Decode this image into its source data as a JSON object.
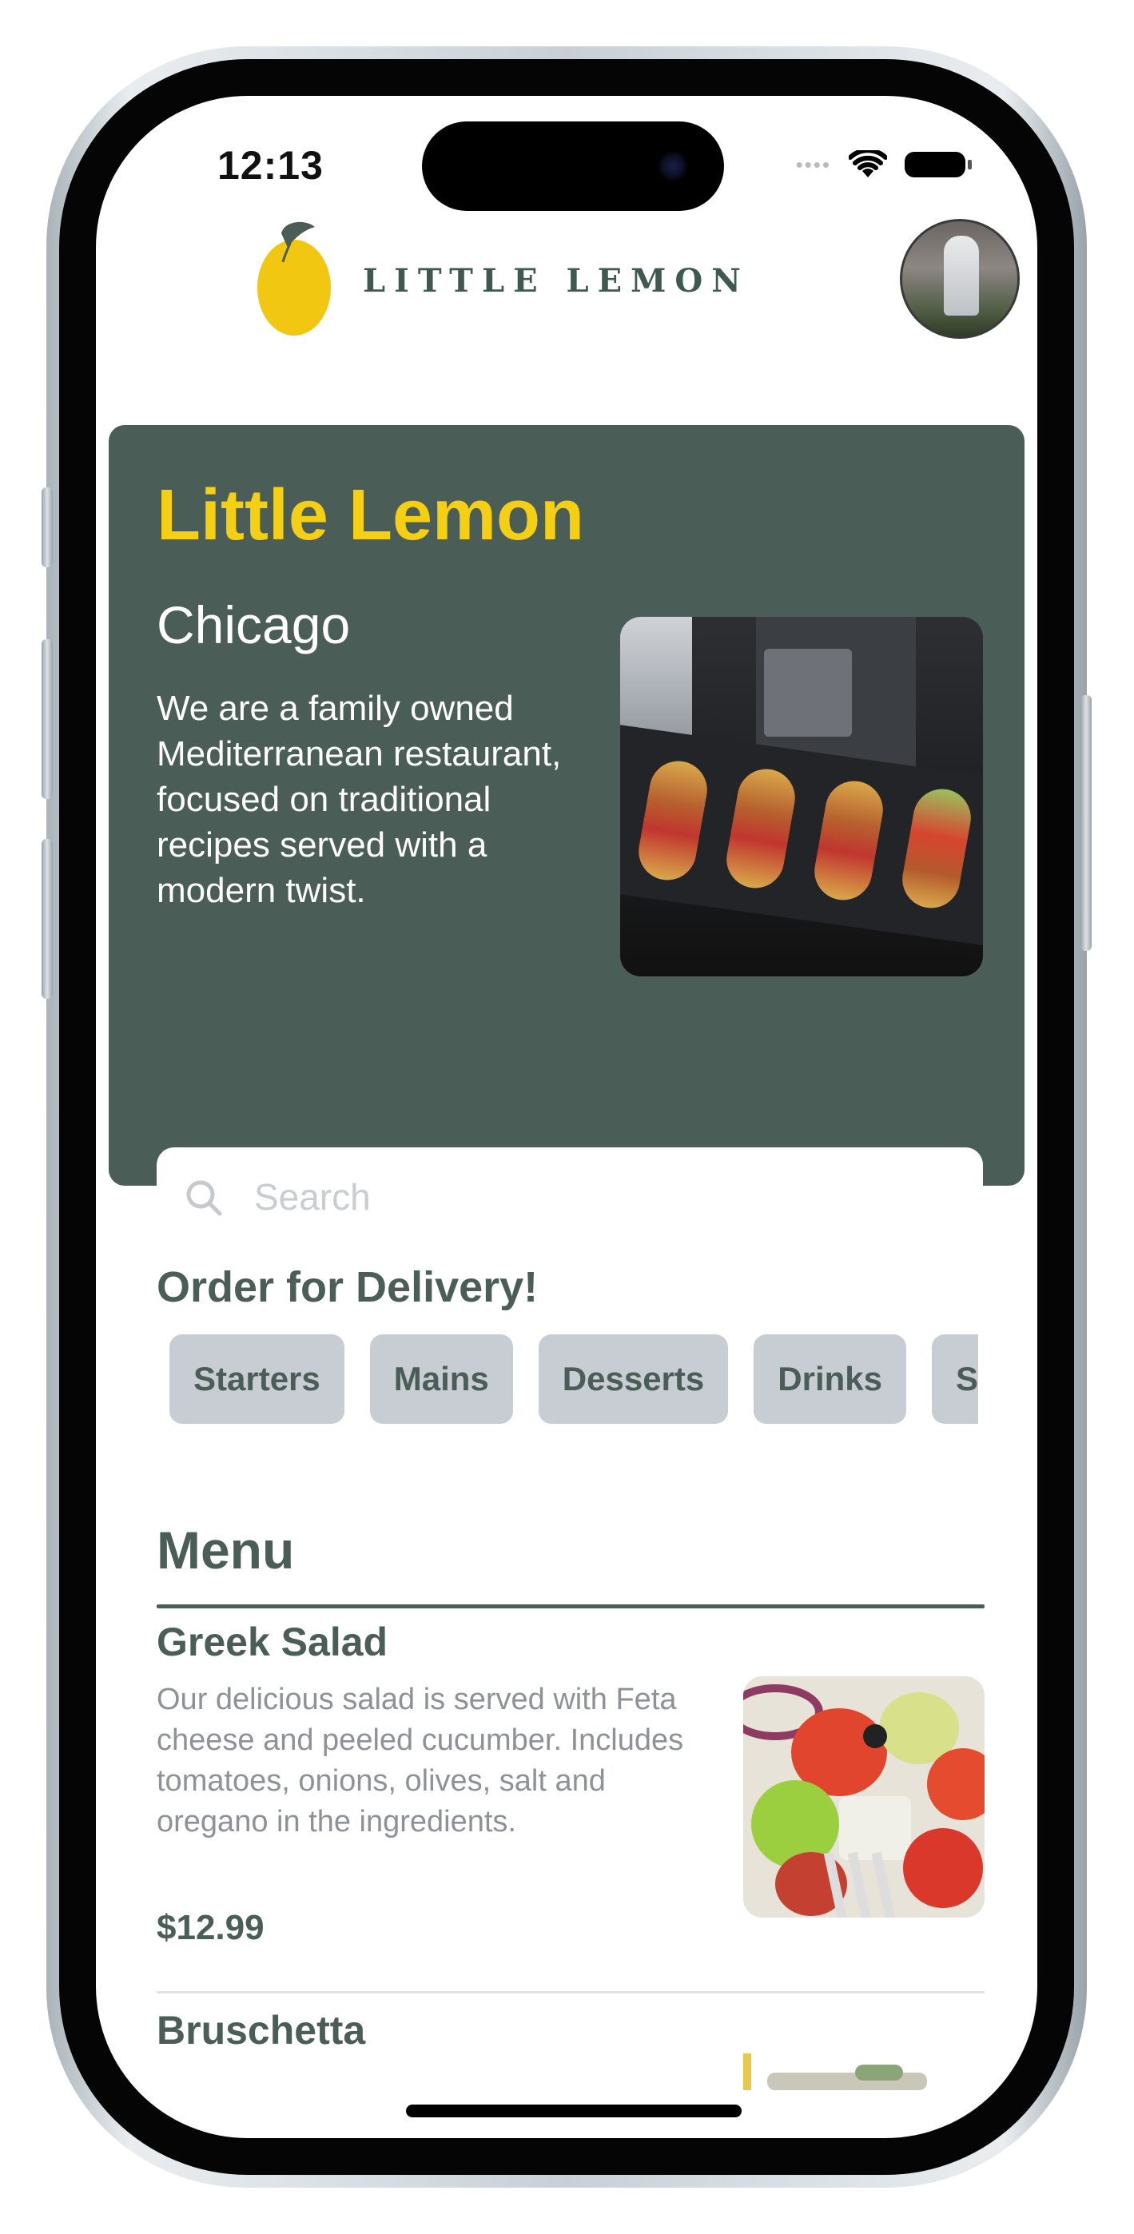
{
  "status_bar": {
    "time": "12:13"
  },
  "header": {
    "logo_text": "LITTLE LEMON",
    "logo_icon": "lemon-icon",
    "avatar_icon": "profile-avatar"
  },
  "hero": {
    "title": "Little Lemon",
    "city": "Chicago",
    "description": "We are a family owned Mediterranean restaurant, focused on traditional recipes served with a modern twist.",
    "search_placeholder": "Search",
    "search_icon": "search-icon"
  },
  "delivery": {
    "title": "Order for Delivery!",
    "categories": [
      "Starters",
      "Mains",
      "Desserts",
      "Drinks",
      "Specials"
    ]
  },
  "menu": {
    "title": "Menu",
    "items": [
      {
        "name": "Greek Salad",
        "description": "Our delicious salad is served with Feta cheese and peeled cucumber. Includes tomatoes, onions, olives, salt and oregano in the ingredients.",
        "price": "$12.99"
      },
      {
        "name": "Bruschetta"
      }
    ]
  },
  "colors": {
    "primary_green": "#4b5d57",
    "accent_yellow": "#f4cf14",
    "chip_gray": "#c8ccd3"
  }
}
